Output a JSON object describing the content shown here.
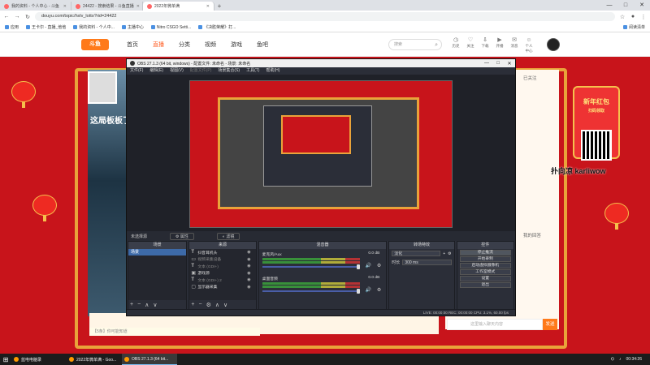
{
  "browser": {
    "tabs": [
      {
        "label": "我的资料 - 个人中心 - 斗鱼"
      },
      {
        "label": "24422 - 搜索结果 - 斗鱼直播"
      },
      {
        "label": "2022年微单满"
      }
    ],
    "new_tab": "+",
    "window_buttons": {
      "minimize": "—",
      "maximize": "□",
      "close": "✕"
    },
    "url": "douyu.com/topic/hxlv_lotto?rid=24422",
    "bookmarks": [
      "应用",
      "王卡尔 - 直播_他他",
      "我的资料 - 个人中...",
      "主播中心",
      "Nitro CSGO Setti...",
      "《决胜荣耀》打..."
    ],
    "reading_list": "阅读清单"
  },
  "site": {
    "logo": "斗鱼",
    "nav": [
      "首页",
      "直播",
      "分类",
      "视频",
      "游戏",
      "鱼吧"
    ],
    "search_placeholder": "搜索",
    "header_icons": [
      "历史",
      "关注",
      "下载",
      "开播",
      "消息",
      "个人中心"
    ]
  },
  "stage": {
    "title": "这局板板了",
    "chat_lines": [
      "已关注",
      "我的回答",
      "新年红包"
    ],
    "badge": "新年红包",
    "badge_sub": "扫码领取",
    "watermark": "扑向凉 karliwow",
    "barrage": "【5条】你可能知道",
    "chat_placeholder": "这里输入聊天内容",
    "send": "发送"
  },
  "obs": {
    "title": "OBS 27.1.3 (64 bit, windows) - 配置文件: 未命名 - 场景: 未命名",
    "menu": [
      "文件(F)",
      "编辑(E)",
      "视图(V)",
      "配置文件(P)",
      "场景集合(S)",
      "工具(T)",
      "帮助(H)"
    ],
    "scene_strip": {
      "label": "未选择源",
      "props": "属性",
      "filters": "滤镜"
    },
    "docks": {
      "scenes": "场景",
      "sources": "来源",
      "mixer": "混音器",
      "transitions": "转场特效",
      "controls": "控件"
    },
    "scene_list": [
      "场景"
    ],
    "sources_list": [
      {
        "label": "抖音耳机头",
        "dim": false
      },
      {
        "label": "视频采集设备",
        "dim": true
      },
      {
        "label": "文本 (GDI+)",
        "dim": true
      },
      {
        "label": "游戏源",
        "dim": false
      },
      {
        "label": "文本 (GDI+) 2",
        "dim": true
      },
      {
        "label": "显示器采集",
        "dim": false
      }
    ],
    "mixer": [
      {
        "name": "麦克风/Aux",
        "db": "0.0 dB"
      },
      {
        "name": "桌面音频",
        "db": "0.0 dB"
      }
    ],
    "transition": {
      "type": "淡化",
      "duration_label": "时长",
      "duration": "300 ms"
    },
    "controls": [
      "停止推流",
      "开始录制",
      "启动虚拟摄像机",
      "工作室模式",
      "设置",
      "退出"
    ],
    "status": "LIVE: 00:00:00   REC: 00:00:00   CPU: 3.1%, 60.00 fps"
  },
  "taskbar": {
    "items": [
      "蓝电电脑录",
      "2022年微单满 - Goo...",
      "OBS 27.1.3 (64 bit..."
    ],
    "time": "00:34:26"
  }
}
